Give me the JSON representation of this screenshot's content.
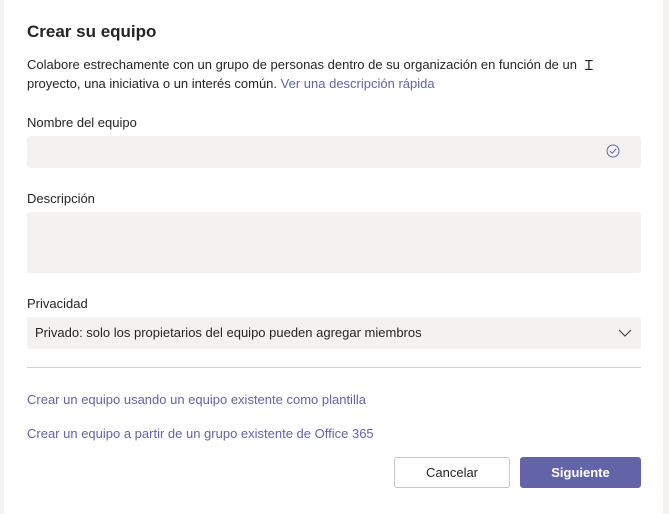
{
  "dialog": {
    "title": "Crear su equipo",
    "intro_text": "Colabore estrechamente con un grupo de personas dentro de su organización en función de un proyecto, una iniciativa o un interés común.",
    "intro_link": "Ver una descripción rápida"
  },
  "fields": {
    "team_name": {
      "label": "Nombre del equipo",
      "value": "",
      "status_icon": "check-circle-icon"
    },
    "description": {
      "label": "Descripción",
      "value": ""
    },
    "privacy": {
      "label": "Privacidad",
      "selected": "Privado: solo los propietarios del equipo pueden agregar miembros",
      "icon": "chevron-down-icon"
    }
  },
  "links": {
    "from_template": "Crear un equipo usando un equipo existente como plantilla",
    "from_group": "Crear un equipo a partir de un grupo existente de Office 365"
  },
  "buttons": {
    "cancel": "Cancelar",
    "next": "Siguiente"
  },
  "colors": {
    "accent": "#6264a7",
    "field_background": "#f3f2f1"
  }
}
